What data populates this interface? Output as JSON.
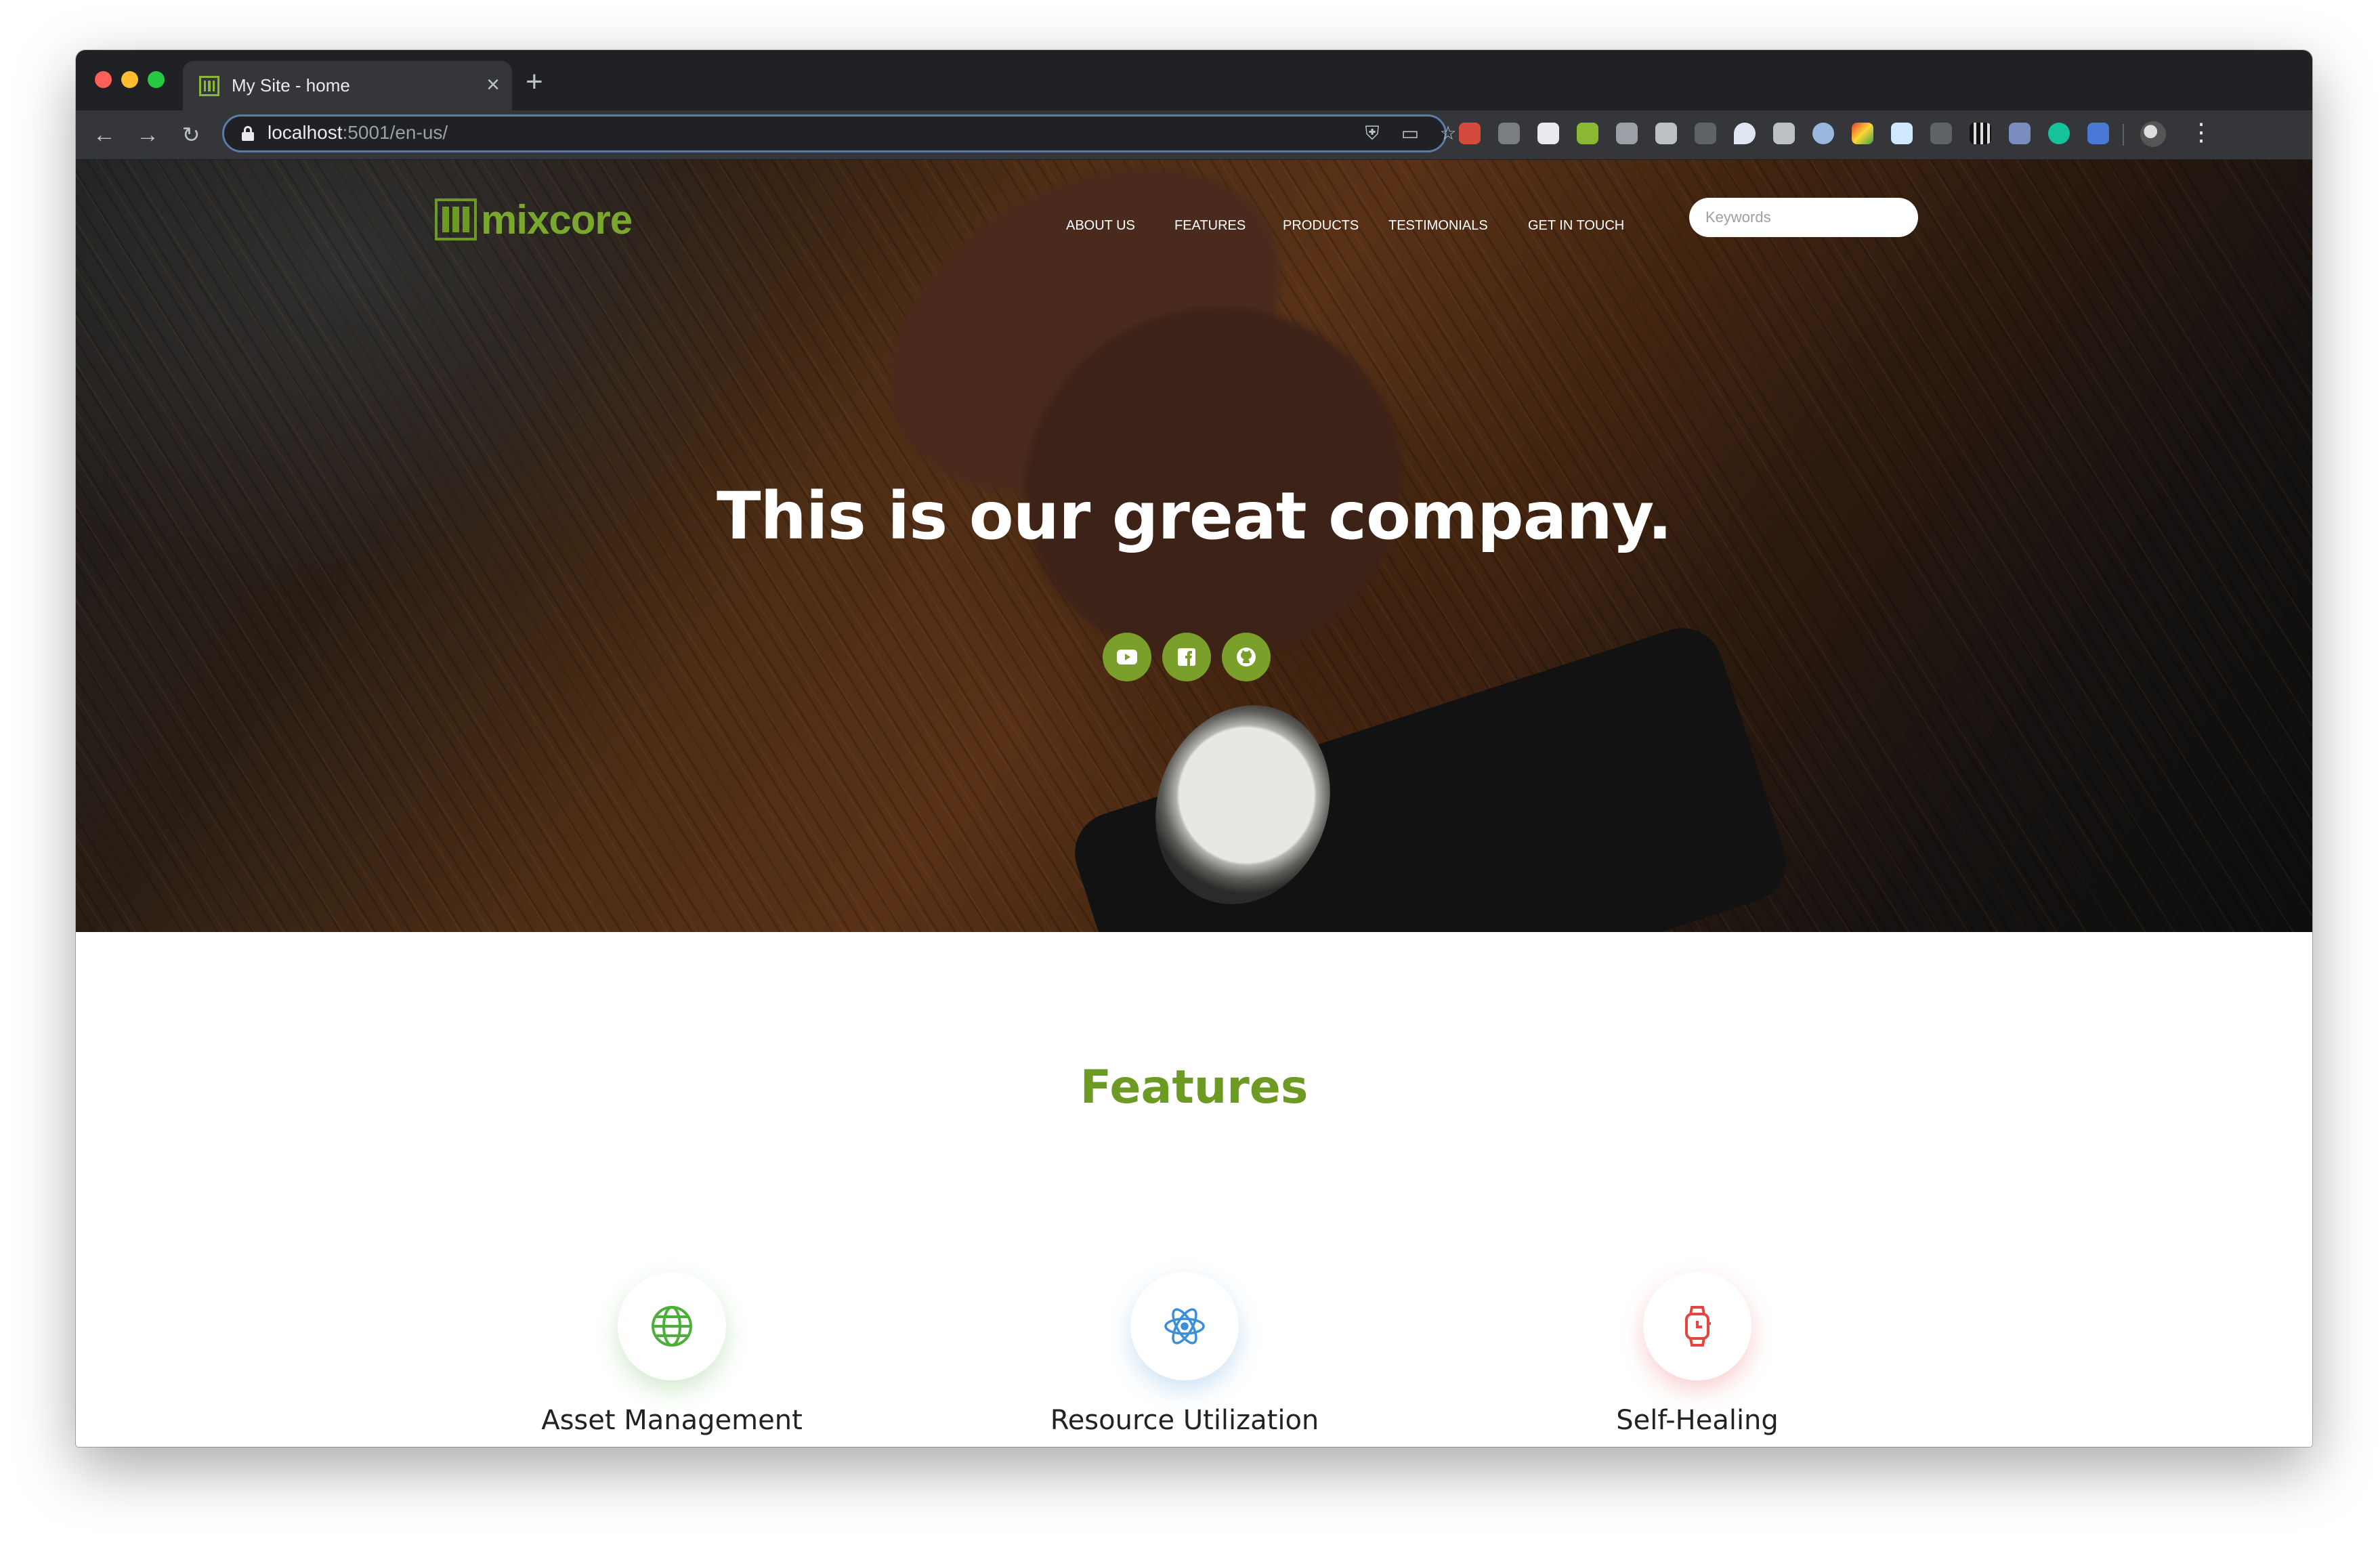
{
  "browser": {
    "tab_title": "My Site - home",
    "url_host": "localhost",
    "url_rest": ":5001/en-us/"
  },
  "site": {
    "logo_text": "mixcore",
    "nav": [
      "ABOUT US",
      "FEATURES",
      "PRODUCTS",
      "TESTIMONIALS",
      "GET IN TOUCH"
    ],
    "search_placeholder": "Keywords",
    "hero_title": "This is our great company.",
    "socials": [
      "youtube-icon",
      "facebook-icon",
      "github-icon"
    ],
    "features_heading": "Features",
    "features": [
      {
        "label": "Asset Management",
        "icon": "globe-icon",
        "color": "#4caf3a"
      },
      {
        "label": "Resource Utilization",
        "icon": "atom-icon",
        "color": "#3a8fd8"
      },
      {
        "label": "Self-Healing",
        "icon": "smartwatch-icon",
        "color": "#e2463f"
      }
    ]
  },
  "colors": {
    "brand_green": "#6c9a23",
    "social_green": "#7a9f2a"
  }
}
